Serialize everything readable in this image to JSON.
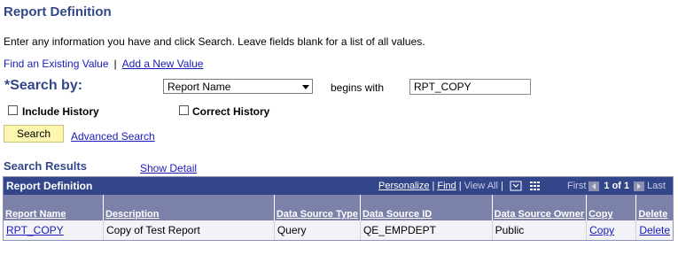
{
  "page": {
    "title": "Report Definition",
    "instructions": "Enter any information you have and click Search. Leave fields blank for a list of all values."
  },
  "nav": {
    "find_existing": "Find an Existing Value",
    "separator": "|",
    "add_new": "Add a New Value"
  },
  "search": {
    "required_marker": "*",
    "search_by_label": "Search by:",
    "field_selected": "Report Name",
    "operator": "begins with",
    "value": "RPT_COPY",
    "include_history": "Include History",
    "correct_history": "Correct History",
    "button": "Search",
    "advanced": "Advanced Search"
  },
  "results": {
    "title": "Search Results",
    "show_detail": "Show Detail"
  },
  "grid": {
    "title": "Report Definition",
    "personalize": "Personalize",
    "find": "Find",
    "view_all": "View All",
    "sep": "|",
    "first": "First",
    "count": "1 of 1",
    "last": "Last",
    "columns": [
      "Report Name",
      "Description",
      "Data Source Type",
      "Data Source ID",
      "Data Source Owner",
      "Copy",
      "Delete"
    ],
    "rows": [
      [
        "RPT_COPY",
        "Copy of Test Report",
        "Query",
        "QE_EMPDEPT",
        "Public",
        "Copy",
        "Delete"
      ]
    ]
  },
  "colors": {
    "header_blue": "#33468a",
    "column_header": "#7b81a9",
    "search_button": "#fcf6b0",
    "link": "#1a1ab8"
  },
  "icons": [
    "download-icon",
    "grid-icon",
    "prev-arrow-icon",
    "next-arrow-icon"
  ]
}
